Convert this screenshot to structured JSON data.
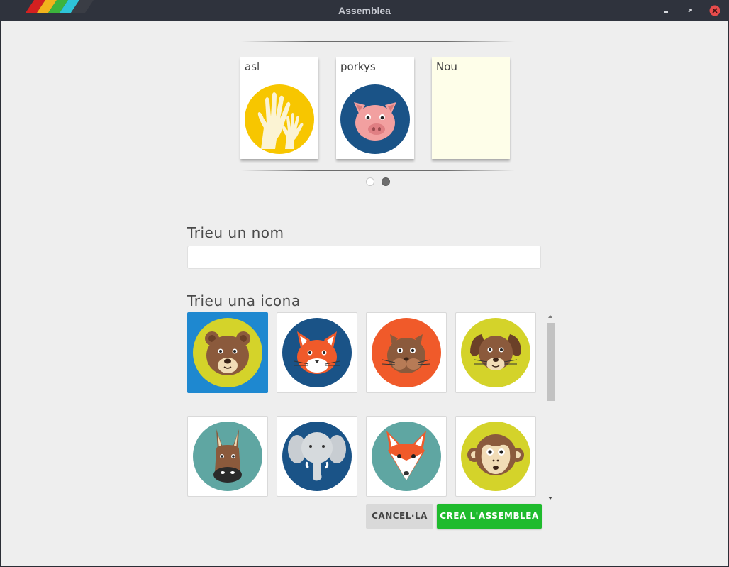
{
  "window": {
    "title": "Assemblea",
    "controls": [
      "minimize-icon",
      "maximize-icon",
      "close-icon"
    ],
    "close_color": "#e74c4c"
  },
  "carousel": {
    "cards": [
      {
        "label": "asl",
        "icon": "hands-icon",
        "bg": "#f7c600"
      },
      {
        "label": "porkys",
        "icon": "pig-icon",
        "bg": "#1a5387"
      },
      {
        "label": "Nou",
        "icon": "",
        "bg": "#fefee9"
      }
    ],
    "page_count": 2,
    "active_page": 2
  },
  "form": {
    "name_label": "Trieu un nom",
    "name_value": "",
    "icon_label": "Trieu una icona",
    "icons": [
      {
        "name": "bear-icon",
        "bg": "#d4d32a",
        "selected": true
      },
      {
        "name": "cat-icon",
        "bg": "#1a5387",
        "selected": false
      },
      {
        "name": "hamster-icon",
        "bg": "#f05a2a",
        "selected": false
      },
      {
        "name": "dog-icon",
        "bg": "#d4d32a",
        "selected": false
      },
      {
        "name": "donkey-icon",
        "bg": "#5fa6a2",
        "selected": false
      },
      {
        "name": "elephant-icon",
        "bg": "#1a5387",
        "selected": false
      },
      {
        "name": "fox-icon",
        "bg": "#5fa6a2",
        "selected": false
      },
      {
        "name": "monkey-icon",
        "bg": "#d4d32a",
        "selected": false
      }
    ]
  },
  "actions": {
    "cancel_label": "CANCEL·LA",
    "create_label": "CREA L'ASSEMBLEA",
    "create_color": "#1fbb2d"
  }
}
